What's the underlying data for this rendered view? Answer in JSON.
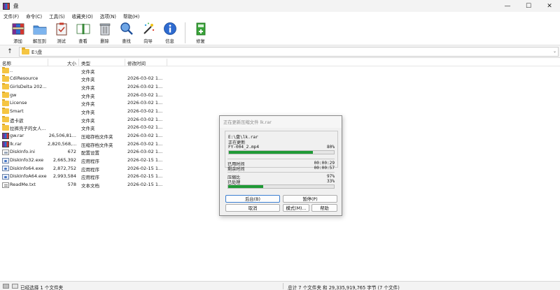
{
  "window": {
    "title": "盘",
    "controls": {
      "minimize": "—",
      "maximize": "☐",
      "close": "✕"
    }
  },
  "menu": [
    "文件(F)",
    "命令(C)",
    "工具(S)",
    "收藏夹(O)",
    "选项(N)",
    "帮助(H)"
  ],
  "toolbar": {
    "add": "添加",
    "extract": "解压到",
    "test": "测试",
    "view": "查看",
    "delete": "删除",
    "find": "查找",
    "wizard": "向导",
    "info": "信息",
    "repair": "修复"
  },
  "address": {
    "up": "↑",
    "path": "E:\\盘",
    "dropdown": "⌄"
  },
  "columns": {
    "name": "名称",
    "size": "大小",
    "type": "类型",
    "modified": "修改时间"
  },
  "files": [
    {
      "name": "..",
      "size": "",
      "type": "文件夹",
      "modified": "",
      "icon": "folder"
    },
    {
      "name": "CdiResource",
      "size": "",
      "type": "文件夹",
      "modified": "2026-03-02 1...",
      "icon": "folder"
    },
    {
      "name": "GirlsDelta 202...",
      "size": "",
      "type": "文件夹",
      "modified": "2026-03-02 1...",
      "icon": "folder"
    },
    {
      "name": "gw",
      "size": "",
      "type": "文件夹",
      "modified": "2026-03-02 1...",
      "icon": "folder"
    },
    {
      "name": "License",
      "size": "",
      "type": "文件夹",
      "modified": "2026-03-02 1...",
      "icon": "folder"
    },
    {
      "name": "Smart",
      "size": "",
      "type": "文件夹",
      "modified": "2026-03-02 1...",
      "icon": "folder"
    },
    {
      "name": "遗卡欲",
      "size": "",
      "type": "文件夹",
      "modified": "2026-03-02 1...",
      "icon": "folder"
    },
    {
      "name": "拉裤壳子的女人...",
      "size": "",
      "type": "文件夹",
      "modified": "2026-03-02 1...",
      "icon": "folder"
    },
    {
      "name": "gw.rar",
      "size": "26,506,81...",
      "type": "压缩存档文件夹",
      "modified": "2026-03-02 1...",
      "icon": "rar"
    },
    {
      "name": "lk.rar",
      "size": "2,820,568,...",
      "type": "压缩存档文件夹",
      "modified": "2026-03-02 1...",
      "icon": "rar"
    },
    {
      "name": "DiskInfo.ini",
      "size": "672",
      "type": "配置设置",
      "modified": "2026-03-02 1...",
      "icon": "ini"
    },
    {
      "name": "DiskInfo32.exe",
      "size": "2,665,392",
      "type": "应用程序",
      "modified": "2026-02-15 1...",
      "icon": "exe"
    },
    {
      "name": "DiskInfo64.exe",
      "size": "2,872,752",
      "type": "应用程序",
      "modified": "2026-02-15 1...",
      "icon": "exe"
    },
    {
      "name": "DiskInfoA64.exe",
      "size": "2,993,584",
      "type": "应用程序",
      "modified": "2026-02-15 1...",
      "icon": "exe"
    },
    {
      "name": "ReadMe.txt",
      "size": "578",
      "type": "文本文档",
      "modified": "2026-02-15 1...",
      "icon": "txt"
    }
  ],
  "status": {
    "selected": "已经选择 1 个文件夹",
    "total": "总计 7 个文件夹 和 29,335,919,765 字节 (7 个文件)"
  },
  "dialog": {
    "title": "正在更新压缩文件 lk.rar",
    "archive_path": "E:\\盘\\lk.rar",
    "action": "正在更新",
    "current_file": "FY-004_2.mp4",
    "file_percent_label": "80%",
    "file_progress": 0.8,
    "elapsed_label": "已用时间",
    "elapsed": "00:00:29",
    "remaining_label": "剩余时间",
    "remaining": "00:00:57",
    "ratio_label": "压缩比",
    "ratio": "97%",
    "processed_label": "已处理",
    "processed_percent_label": "33%",
    "total_progress": 0.33,
    "buttons": {
      "background": "后台(B)",
      "pause": "暂停(P)",
      "cancel": "取消",
      "mode": "模式(M)...",
      "help": "帮助"
    }
  },
  "colors": {
    "progress": "#1f9a36",
    "folder": "#f5c542",
    "accent_focus": "#3c7fd1"
  }
}
